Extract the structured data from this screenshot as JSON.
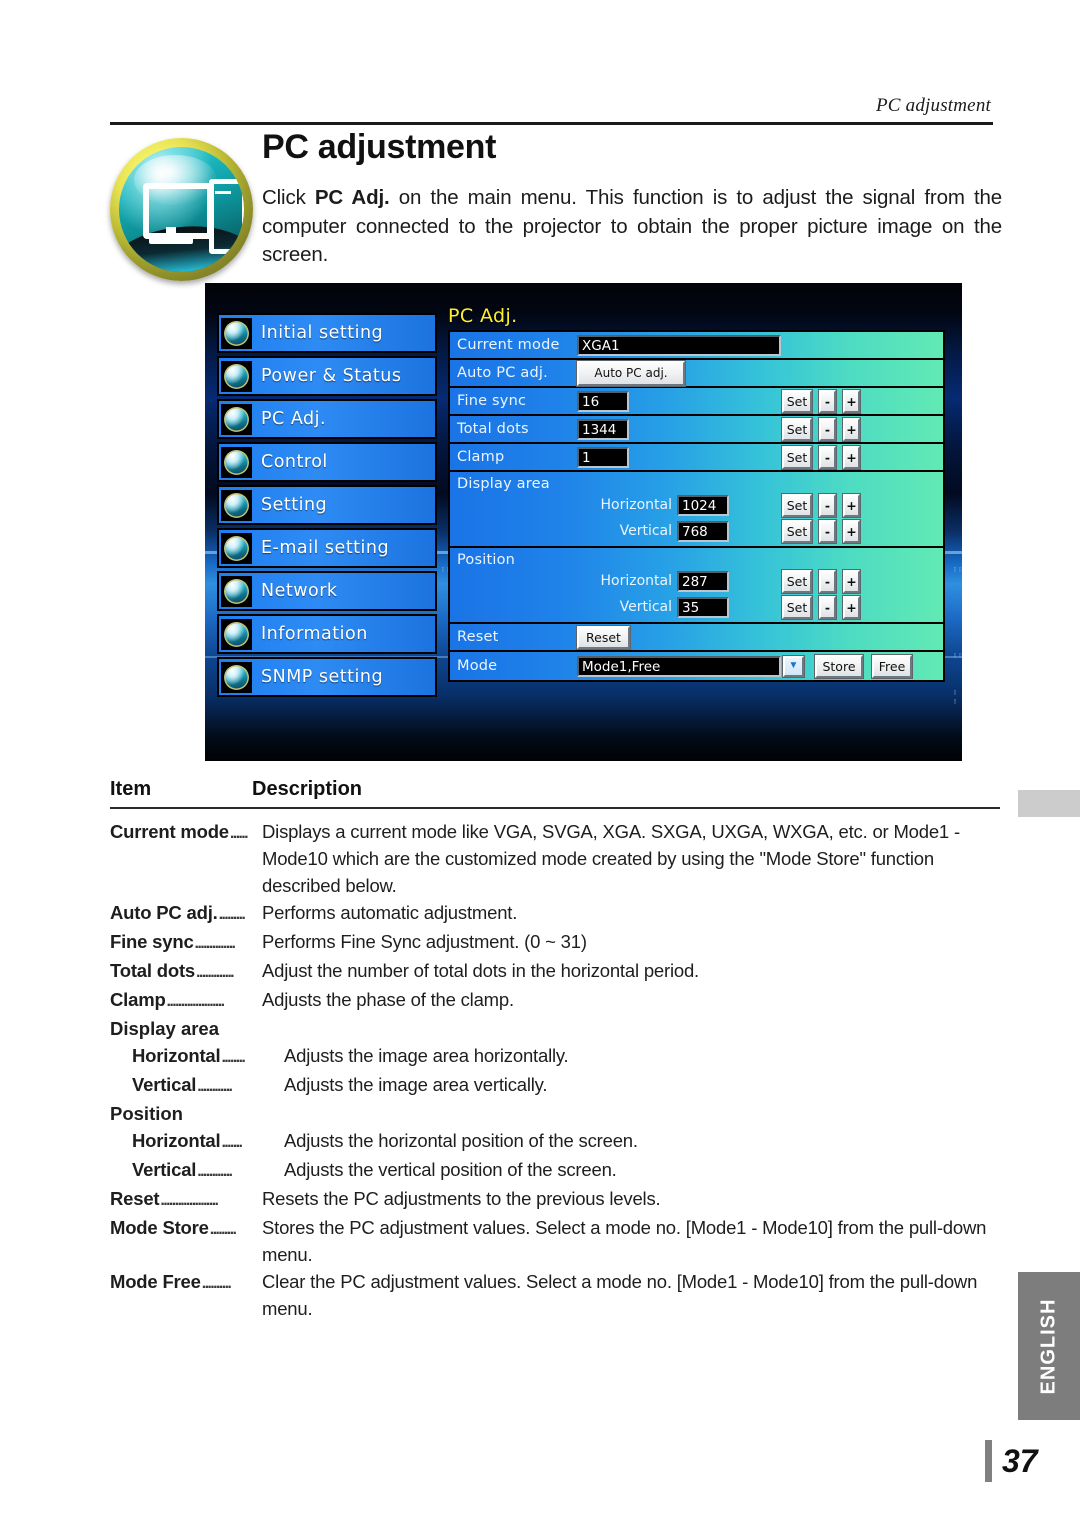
{
  "running_header": "PC adjustment",
  "title": "PC adjustment",
  "intro": "Click PC Adj. on the main menu. This function is to adjust the signal from the computer connected to the projector to obtain the proper picture image on the screen.",
  "intro_bold": "PC Adj.",
  "intro_before": "Click ",
  "intro_after": " on the main menu. This function is to adjust the signal from the computer connected to the projector to obtain the proper picture image on the screen.",
  "badge_icon": "computer-monitor-tower-icon",
  "screenshot": {
    "sidebar": {
      "items": [
        {
          "label": "Initial setting",
          "icon": "initial-setting-icon"
        },
        {
          "label": "Power & Status",
          "icon": "power-status-icon"
        },
        {
          "label": "PC Adj.",
          "icon": "pc-adj-icon"
        },
        {
          "label": "Control",
          "icon": "control-icon"
        },
        {
          "label": "Setting",
          "icon": "setting-icon"
        },
        {
          "label": "E-mail setting",
          "icon": "email-setting-icon"
        },
        {
          "label": "Network",
          "icon": "network-icon"
        },
        {
          "label": "Information",
          "icon": "information-icon"
        },
        {
          "label": "SNMP setting",
          "icon": "snmp-setting-icon"
        }
      ]
    },
    "panel": {
      "title": "PC Adj.",
      "rows": {
        "current_mode": {
          "label": "Current mode",
          "value": "XGA1"
        },
        "auto_pc_adj": {
          "label": "Auto PC adj.",
          "button": "Auto PC adj."
        },
        "fine_sync": {
          "label": "Fine sync",
          "value": "16"
        },
        "total_dots": {
          "label": "Total dots",
          "value": "1344"
        },
        "clamp": {
          "label": "Clamp",
          "value": "1"
        },
        "display_area": {
          "label": "Display area",
          "horizontal": {
            "label": "Horizontal",
            "value": "1024"
          },
          "vertical": {
            "label": "Vertical",
            "value": "768"
          }
        },
        "position": {
          "label": "Position",
          "horizontal": {
            "label": "Horizontal",
            "value": "287"
          },
          "vertical": {
            "label": "Vertical",
            "value": "35"
          }
        },
        "reset": {
          "label": "Reset",
          "button": "Reset"
        },
        "mode": {
          "label": "Mode",
          "value": "Mode1,Free",
          "store": "Store",
          "free": "Free"
        }
      },
      "buttons": {
        "set": "Set",
        "minus": "-",
        "plus": "+",
        "dropdown_arrow": "▼"
      }
    },
    "colors": {
      "row_gradient_left": "#1a74e6",
      "row_gradient_right": "#62e9b4",
      "menu_blue": "#2e8bf4",
      "panel_title_yellow": "#ffef2b"
    }
  },
  "table": {
    "head_item": "Item",
    "head_description": "Description",
    "rows": [
      {
        "term": "Current mode",
        "leader": "......",
        "desc": "Displays a current mode like VGA, SVGA, XGA. SXGA, UXGA, WXGA, etc. or Mode1 - Mode10 which are the customized mode created by using the \"Mode Store\" function described below.",
        "indent": false
      },
      {
        "term": "Auto PC adj.",
        "leader": ".........",
        "desc": "Performs automatic adjustment.",
        "indent": false
      },
      {
        "term": "Fine sync",
        "leader": "..............",
        "desc": "Performs Fine Sync adjustment. (0 ~ 31)",
        "indent": false
      },
      {
        "term": "Total dots",
        "leader": ".............",
        "desc": "Adjust the number of total dots in the horizontal period.",
        "indent": false
      },
      {
        "term": "Clamp",
        "leader": "....................",
        "desc": "Adjusts the phase of the clamp.",
        "indent": false
      },
      {
        "term": "Display area",
        "leader": "",
        "desc": "",
        "group": true
      },
      {
        "term": "Horizontal",
        "leader": "........",
        "desc": "Adjusts the image area horizontally.",
        "indent": true
      },
      {
        "term": "Vertical",
        "leader": "............",
        "desc": "Adjusts the image area vertically.",
        "indent": true
      },
      {
        "term": "Position",
        "leader": "",
        "desc": "",
        "group": true
      },
      {
        "term": "Horizontal",
        "leader": ".......",
        "desc": "Adjusts the horizontal position of the screen.",
        "indent": true
      },
      {
        "term": "Vertical",
        "leader": "............",
        "desc": "Adjusts the vertical position of the screen.",
        "indent": true
      },
      {
        "term": "Reset",
        "leader": "....................",
        "desc": "Resets the PC adjustments to the previous levels.",
        "indent": false
      },
      {
        "term": "Mode Store",
        "leader": ".........",
        "desc": "Stores the PC adjustment values. Select a mode no. [Mode1 - Mode10] from the pull-down menu.",
        "indent": false
      },
      {
        "term": "Mode Free",
        "leader": "..........",
        "desc": "Clear the PC adjustment values. Select a mode no.  [Mode1 - Mode10] from the pull-down menu.",
        "indent": false
      }
    ]
  },
  "side_tab": "ENGLISH",
  "page_number": "37"
}
